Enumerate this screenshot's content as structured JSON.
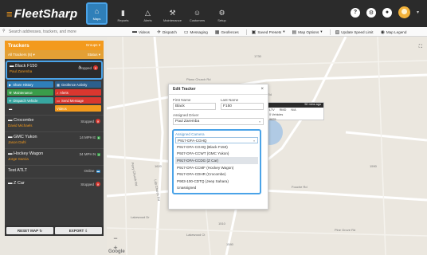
{
  "app": {
    "logo_text": "FleetSharp",
    "logo_glyph": "≡"
  },
  "nav": [
    {
      "label": "Maps",
      "icon": "map-icon",
      "glyph": "⌂"
    },
    {
      "label": "Reports",
      "icon": "bar-chart-icon",
      "glyph": "▮"
    },
    {
      "label": "Alerts",
      "icon": "bell-icon",
      "glyph": "△"
    },
    {
      "label": "Maintenance",
      "icon": "wrench-icon",
      "glyph": "⚒"
    },
    {
      "label": "Customers",
      "icon": "people-icon",
      "glyph": "☺"
    },
    {
      "label": "Setup",
      "icon": "gear-icon",
      "glyph": "⚙"
    }
  ],
  "toolbar": {
    "search_placeholder": "Search addresses, trackers, and more",
    "items": [
      "Videos",
      "Dispatch",
      "Messaging",
      "Geofences",
      "Saved Presets",
      "Map Options",
      "Update Speed Limit",
      "Map Legend"
    ]
  },
  "sidebar": {
    "title": "Trackers",
    "groups_label": "Groups",
    "filter_label": "All Trackers (6)",
    "status_label": "Status",
    "selected": {
      "name": "Black F150",
      "driver": "Paul Zaremba",
      "status": "Stopped"
    },
    "actions": [
      "Share History",
      "Geofence Activity",
      "Maintenance",
      "Alerts",
      "Dispatch Vehicle",
      "Send Message",
      "",
      "Videos"
    ],
    "trackers": [
      {
        "name": "Crocombe",
        "driver": "David Michaels",
        "status": "Stopped",
        "type": "red"
      },
      {
        "name": "GMC Yukon",
        "driver": "Jason Dahl",
        "status": "14 MPH E",
        "type": "green"
      },
      {
        "name": "Hockey Wagon",
        "driver": "Jorge Garcia",
        "status": "34 MPH N",
        "type": "green"
      },
      {
        "name": "Test ATLT",
        "driver": "",
        "status": "Online",
        "type": "blue"
      },
      {
        "name": "Z Car",
        "driver": "",
        "status": "Stopped",
        "type": "red"
      }
    ],
    "reset_label": "RESET MAP",
    "export_label": "EXPORT"
  },
  "map": {
    "roads": [
      "Plano Church Rd",
      "S Church Rd",
      "Fouche Rd",
      "Perry Church Rd",
      "Lab Church Rd",
      "Lakewood Dr",
      "Lakewood Ct",
      "Pine Grove Rd",
      "1730",
      "1130",
      "1620",
      "1580",
      "1590",
      "1510"
    ],
    "google": "Google",
    "info_time": "50 mins ago",
    "info_cols": [
      "LTV",
      "RMD",
      "N/A"
    ],
    "info_row2": "0 Vehicles",
    "info_row3": "9825"
  },
  "dialog": {
    "title": "Edit Tracker",
    "first_name_label": "First Name",
    "first_name": "Black",
    "last_name_label": "Last Name",
    "last_name": "F150",
    "driver_label": "Assigned Driver",
    "driver": "Paul Zaremba",
    "camera_label": "Assigned Camera",
    "camera": "P917-DFA-CGHQ",
    "options": [
      "P917-DFA-CGHQ (Black F150)",
      "P927-DFA-CCWT (GMC Yukon)",
      "P917-DFA-CCDG (Z Car)",
      "P917-DFA-CCMF (Hockey Wagon)",
      "P917-DFA-CDHR (Crocombe)",
      "P903-100-CDTQ (Jeep Sahara)",
      "Unassigned"
    ],
    "highlighted_option": 2
  }
}
